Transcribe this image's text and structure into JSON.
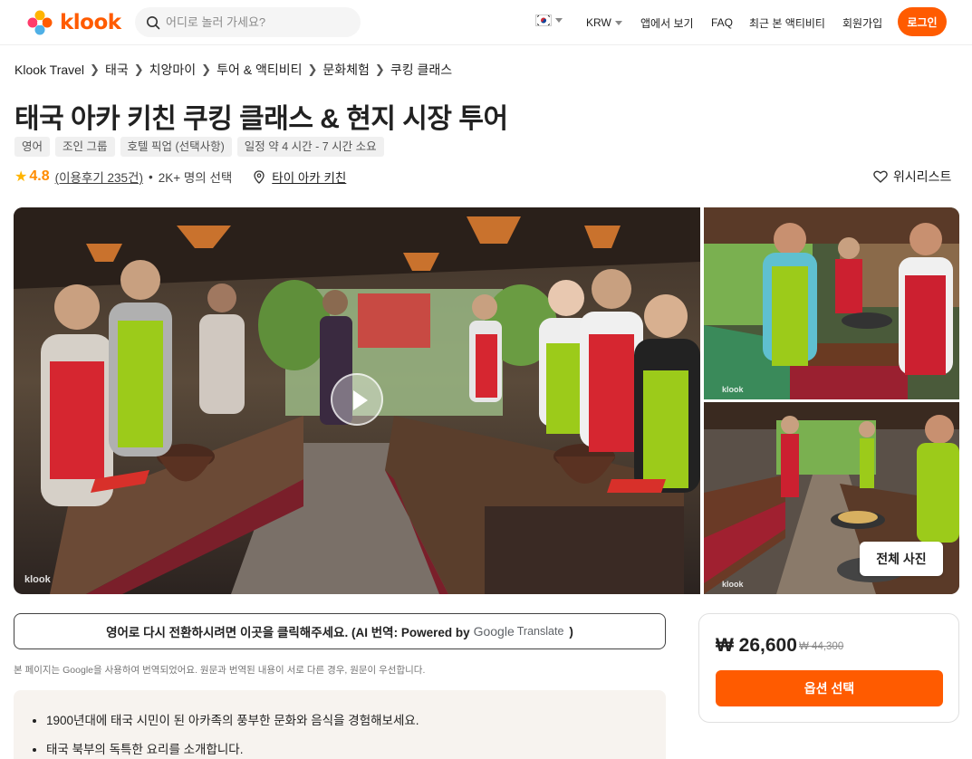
{
  "header": {
    "logo_text": "klook",
    "search_placeholder": "어디로 놀러 가세요?",
    "currency": "KRW",
    "app_link": "앱에서 보기",
    "faq": "FAQ",
    "recent": "최근 본 액티비티",
    "signup": "회원가입",
    "login": "로그인",
    "accent": "#ff5b00"
  },
  "breadcrumb": [
    "Klook Travel",
    "태국",
    "치앙마이",
    "투어 & 액티비티",
    "문화체험",
    "쿠킹 클래스"
  ],
  "product": {
    "title": "태국 아카 키친 쿠킹 클래스 & 현지 시장 투어",
    "tags": [
      "영어",
      "조인 그룹",
      "호텔 픽업 (선택사항)",
      "일정 약 4 시간  - 7 시간  소요"
    ],
    "rating": "4.8",
    "reviews": "(이용후기 235건)",
    "booked": "2K+ 명의 선택",
    "location": "타이 아카 키친",
    "wishlist": "위시리스트"
  },
  "gallery": {
    "watermark": "klook",
    "all_photos": "전체 사진",
    "icons": [
      "play-icon"
    ]
  },
  "translate": {
    "text": "영어로 다시 전환하시려면 이곳을 클릭해주세요. (AI 번역: Powered by",
    "google": "Google",
    "translate_word": "Translate",
    "close_paren": ")",
    "note": "본 페이지는 Google을 사용하여 번역되었어요. 원문과 번역된 내용이 서로 다른 경우, 원문이 우선합니다."
  },
  "highlights": [
    "1900년대에 태국 시민이 된 아카족의 풍부한 문화와 음식을 경험해보세요.",
    "태국 북부의 독특한 요리를 소개합니다."
  ],
  "price_card": {
    "price": "₩ 26,600",
    "old_price": "₩ 44,300",
    "button": "옵션 선택"
  }
}
